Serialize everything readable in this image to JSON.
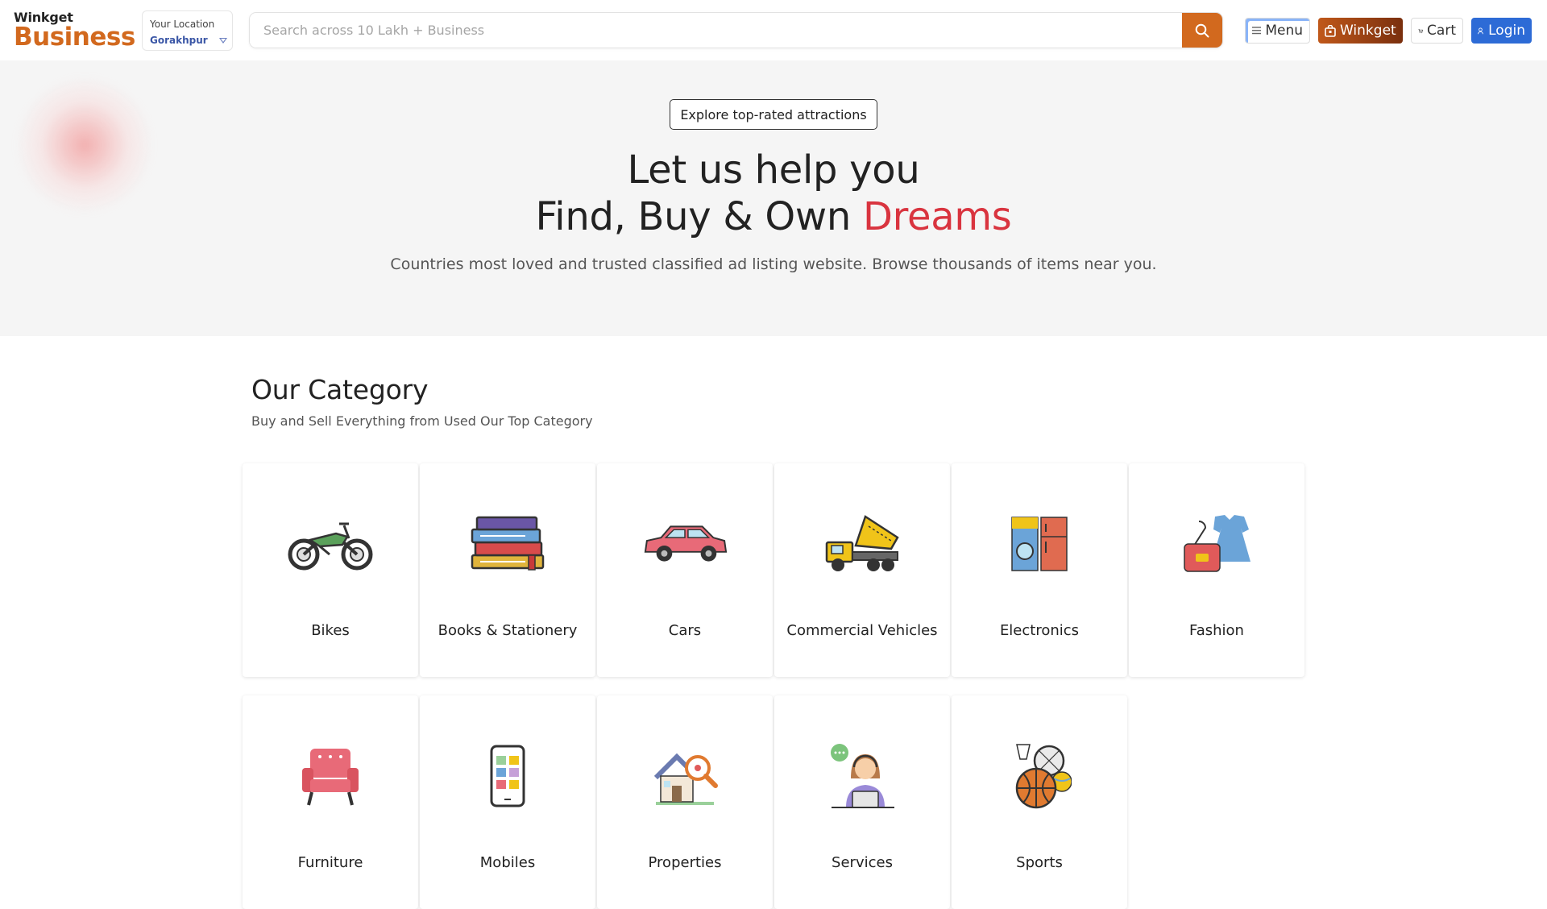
{
  "header": {
    "logo_top": "Winkget",
    "logo_bottom": "Business",
    "location_label": "Your Location",
    "location_value": "Gorakhpur",
    "search_placeholder": "Search across 10 Lakh + Business",
    "buttons": {
      "menu": "Menu",
      "winkget": "Winkget",
      "cart": "Cart",
      "login": "Login"
    }
  },
  "hero": {
    "badge": "Explore top-rated attractions",
    "line1": "Let us help you",
    "line2_prefix": "Find, Buy & Own ",
    "line2_highlight": "Dreams",
    "subtitle": "Countries most loved and trusted classified ad listing website. Browse thousands of items near you."
  },
  "category": {
    "title": "Our Category",
    "subtitle": "Buy and Sell Everything from Used Our Top Category",
    "items": [
      {
        "label": "Bikes",
        "icon": "motorbike-icon"
      },
      {
        "label": "Books & Stationery",
        "icon": "books-icon"
      },
      {
        "label": "Cars",
        "icon": "car-icon"
      },
      {
        "label": "Commercial Vehicles",
        "icon": "dump-truck-icon"
      },
      {
        "label": "Electronics",
        "icon": "appliances-icon"
      },
      {
        "label": "Fashion",
        "icon": "dress-bag-icon"
      },
      {
        "label": "Furniture",
        "icon": "armchair-icon"
      },
      {
        "label": "Mobiles",
        "icon": "smartphone-icon"
      },
      {
        "label": "Properties",
        "icon": "house-search-icon"
      },
      {
        "label": "Services",
        "icon": "support-agent-icon"
      },
      {
        "label": "Sports",
        "icon": "sports-balls-icon"
      }
    ]
  },
  "colors": {
    "brand": "#d2691e",
    "accent_red": "#d9343f",
    "login_blue": "#2d6bd6"
  }
}
